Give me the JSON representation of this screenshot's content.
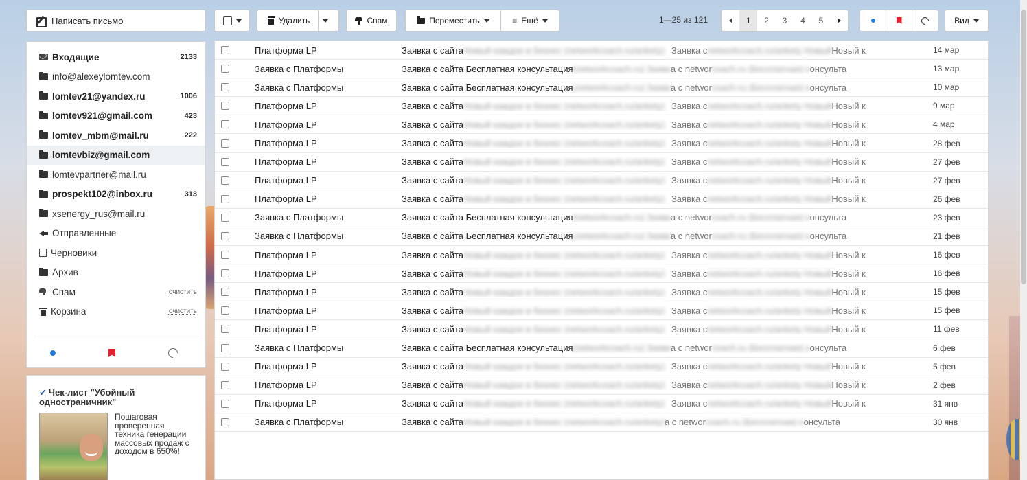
{
  "compose": {
    "label": "Написать письмо"
  },
  "folders": [
    {
      "name": "Входящие",
      "count": "2133",
      "icon": "inbox-icon",
      "bold": true
    },
    {
      "name": "info@alexeylomtev.com",
      "count": "",
      "icon": "folder-icon",
      "bold": false
    },
    {
      "name": "lomtev21@yandex.ru",
      "count": "1006",
      "icon": "folder-icon",
      "bold": true
    },
    {
      "name": "lomtev921@gmail.com",
      "count": "423",
      "icon": "folder-icon",
      "bold": true
    },
    {
      "name": "lomtev_mbm@mail.ru",
      "count": "222",
      "icon": "folder-icon",
      "bold": true
    },
    {
      "name": "lomtevbiz@gmail.com",
      "count": "",
      "icon": "folder-icon",
      "bold": true,
      "active": true
    },
    {
      "name": "lomtevpartner@mail.ru",
      "count": "",
      "icon": "folder-icon",
      "bold": false
    },
    {
      "name": "prospekt102@inbox.ru",
      "count": "313",
      "icon": "folder-icon",
      "bold": true
    },
    {
      "name": "xsenergy_rus@mail.ru",
      "count": "",
      "icon": "folder-icon",
      "bold": false
    },
    {
      "name": "Отправленные",
      "count": "",
      "icon": "sent-icon",
      "bold": false
    },
    {
      "name": "Черновики",
      "count": "",
      "icon": "drafts-icon",
      "bold": false
    },
    {
      "name": "Архив",
      "count": "",
      "icon": "archive-icon",
      "bold": false
    },
    {
      "name": "Спам",
      "clear": "очистить",
      "icon": "spam-icon",
      "bold": false
    },
    {
      "name": "Корзина",
      "clear": "очистить",
      "icon": "trash-icon",
      "bold": false
    }
  ],
  "promo": {
    "title": "Чек-лист \"Убойный одностраничник\"",
    "text": "Пошаговая проверенная техника генерации массовых продаж с доходом в 650%!"
  },
  "toolbar": {
    "delete": "Удалить",
    "spam": "Спам",
    "move": "Переместить",
    "more": "Ещё",
    "range": "1—25 из 121",
    "pages": [
      "1",
      "2",
      "3",
      "4",
      "5"
    ],
    "view": "Вид"
  },
  "messages": [
    {
      "from": "Платформа LP",
      "subject": "Заявка с сайта",
      "date": "14 мар",
      "type": "lp"
    },
    {
      "from": "Заявка с Платформы",
      "subject": "Заявка с сайта Бесплатная консультация",
      "date": "13 мар",
      "type": "cons"
    },
    {
      "from": "Заявка с Платформы",
      "subject": "Заявка с сайта Бесплатная консультация",
      "date": "10 мар",
      "type": "cons"
    },
    {
      "from": "Платформа LP",
      "subject": "Заявка с сайта",
      "date": "9 мар",
      "type": "lp"
    },
    {
      "from": "Платформа LP",
      "subject": "Заявка с сайта",
      "date": "4 мар",
      "type": "lp"
    },
    {
      "from": "Платформа LP",
      "subject": "Заявка с сайта",
      "date": "28 фев",
      "type": "lp"
    },
    {
      "from": "Платформа LP",
      "subject": "Заявка с сайта",
      "date": "27 фев",
      "type": "lp"
    },
    {
      "from": "Платформа LP",
      "subject": "Заявка с сайта",
      "date": "27 фев",
      "type": "lp"
    },
    {
      "from": "Платформа LP",
      "subject": "Заявка с сайта",
      "date": "26 фев",
      "type": "lp"
    },
    {
      "from": "Заявка с Платформы",
      "subject": "Заявка с сайта Бесплатная консультация",
      "date": "23 фев",
      "type": "cons"
    },
    {
      "from": "Заявка с Платформы",
      "subject": "Заявка с сайта Бесплатная консультация",
      "date": "21 фев",
      "type": "cons"
    },
    {
      "from": "Платформа LP",
      "subject": "Заявка с сайта",
      "date": "16 фев",
      "type": "lp"
    },
    {
      "from": "Платформа LP",
      "subject": "Заявка с сайта",
      "date": "16 фев",
      "type": "lp"
    },
    {
      "from": "Платформа LP",
      "subject": "Заявка с сайта",
      "date": "15 фев",
      "type": "lp"
    },
    {
      "from": "Платформа LP",
      "subject": "Заявка с сайта",
      "date": "15 фев",
      "type": "lp"
    },
    {
      "from": "Платформа LP",
      "subject": "Заявка с сайта",
      "date": "11 фев",
      "type": "lp"
    },
    {
      "from": "Заявка с Платформы",
      "subject": "Заявка с сайта Бесплатная консультация",
      "date": "6 фев",
      "type": "cons"
    },
    {
      "from": "Платформа LP",
      "subject": "Заявка с сайта",
      "date": "5 фев",
      "type": "lp"
    },
    {
      "from": "Платформа LP",
      "subject": "Заявка с сайта",
      "date": "2 фев",
      "type": "lp"
    },
    {
      "from": "Платформа LP",
      "subject": "Заявка с сайта",
      "date": "31 янв",
      "type": "lp"
    },
    {
      "from": "Заявка с Платформы",
      "subject": "Заявка с сайта",
      "date": "30 янв",
      "type": "cons2"
    }
  ],
  "preview": {
    "lp_tail": "Заявка с",
    "lp_tail2": "Новый к",
    "cons_tail": "а с networ",
    "cons_tail2": "онсульта"
  }
}
